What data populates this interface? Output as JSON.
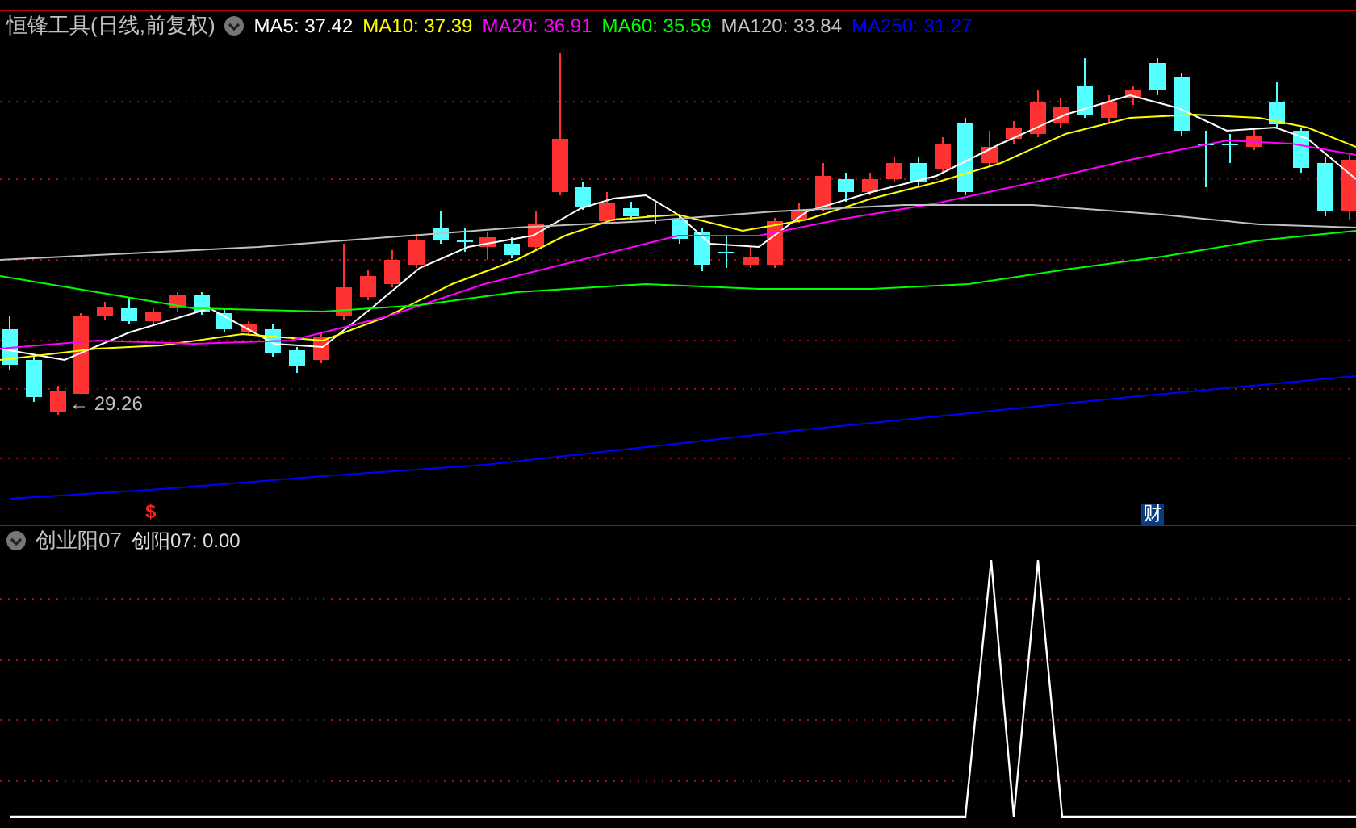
{
  "main_chart": {
    "title": "恒锋工具(日线,前复权)",
    "moving_averages": [
      {
        "label": "MA5: 37.42",
        "color": "#ffffff"
      },
      {
        "label": "MA10: 37.39",
        "color": "#ffff00"
      },
      {
        "label": "MA20: 36.91",
        "color": "#ff00ff"
      },
      {
        "label": "MA60: 35.59",
        "color": "#00ff00"
      },
      {
        "label": "MA120: 33.84",
        "color": "#c0c0c0"
      },
      {
        "label": "MA250: 31.27",
        "color": "#0000ff"
      }
    ],
    "low_price_label": "← 29.26",
    "markers": [
      {
        "kind": "dividend",
        "text": "$"
      },
      {
        "kind": "finance",
        "text": "财"
      }
    ]
  },
  "indicator": {
    "title": "创业阳07",
    "value": "创阳07: 0.00"
  }
}
